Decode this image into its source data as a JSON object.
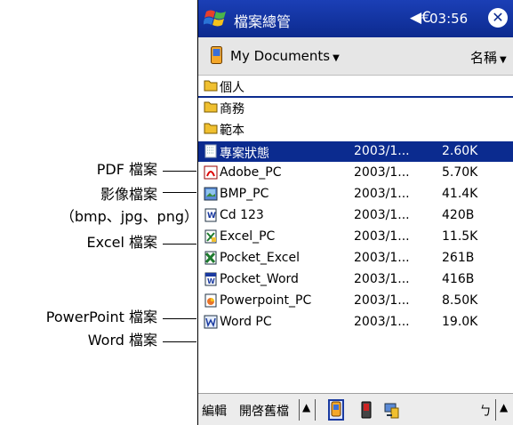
{
  "callouts": [
    {
      "key": "pdf",
      "text": "PDF 檔案"
    },
    {
      "key": "image",
      "text": "影像檔案"
    },
    {
      "key": "image_types",
      "text": "（bmp、jpg、png）"
    },
    {
      "key": "excel",
      "text": "Excel 檔案"
    },
    {
      "key": "powerpoint",
      "text": "PowerPoint 檔案"
    },
    {
      "key": "word",
      "text": "Word 檔案"
    }
  ],
  "titlebar": {
    "app_title": "檔案總管",
    "speaker_glyph": "◀€",
    "time": "03:56",
    "close_glyph": "✕"
  },
  "folderbar": {
    "current_folder": "My Documents",
    "sort_label": "名稱"
  },
  "folders": [
    {
      "name": "個人"
    },
    {
      "name": "商務"
    },
    {
      "name": "範本"
    }
  ],
  "files": [
    {
      "name": "專案狀態",
      "date": "2003/1...",
      "size": "2.60K",
      "icon": "note-icon",
      "selected": true
    },
    {
      "name": "Adobe_PC",
      "date": "2003/1...",
      "size": "5.70K",
      "icon": "pdf-file-icon"
    },
    {
      "name": "BMP_PC",
      "date": "2003/1...",
      "size": "41.4K",
      "icon": "image-file-icon"
    },
    {
      "name": "Cd 123",
      "date": "2003/1...",
      "size": "420B",
      "icon": "word-file-icon"
    },
    {
      "name": "Excel_PC",
      "date": "2003/1...",
      "size": "11.5K",
      "icon": "excel-file-icon"
    },
    {
      "name": "Pocket_Excel",
      "date": "2003/1...",
      "size": "261B",
      "icon": "excel-file-icon"
    },
    {
      "name": "Pocket_Word",
      "date": "2003/1...",
      "size": "416B",
      "icon": "word-file-icon"
    },
    {
      "name": "Powerpoint_PC",
      "date": "2003/1...",
      "size": "8.50K",
      "icon": "powerpoint-file-icon"
    },
    {
      "name": "Word PC",
      "date": "2003/1...",
      "size": "19.0K",
      "icon": "word-doc-file-icon"
    }
  ],
  "menubar": {
    "edit_label": "編輯",
    "open_label": "開啓舊檔",
    "up_glyph": "▲",
    "back_glyph": "ㄅ"
  },
  "colors": {
    "title_bar": "#0c2a8e",
    "selection": "#0b2b8f",
    "folder_yellow": "#f0c030"
  }
}
